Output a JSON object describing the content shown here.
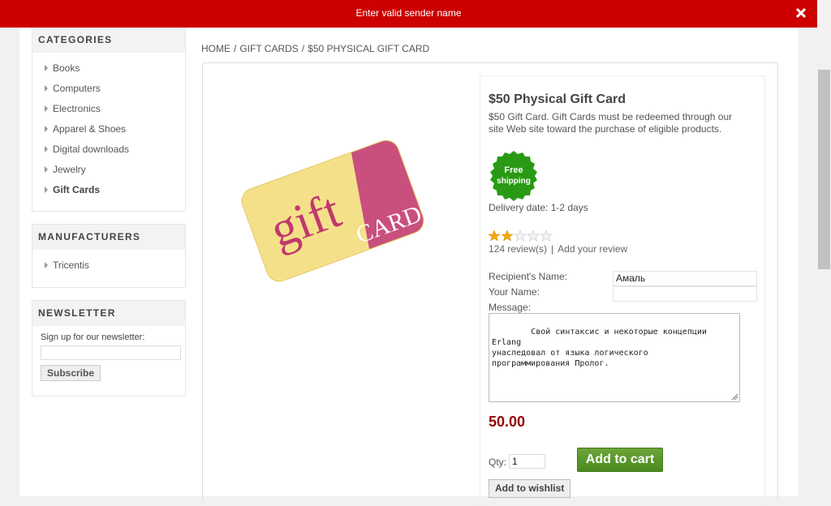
{
  "notification": {
    "text": "Enter valid sender name",
    "close_icon": "close-icon",
    "color": "#cc0000"
  },
  "sidebar": {
    "categories": {
      "title": "CATEGORIES",
      "items": [
        {
          "label": "Books"
        },
        {
          "label": "Computers"
        },
        {
          "label": "Electronics"
        },
        {
          "label": "Apparel & Shoes"
        },
        {
          "label": "Digital downloads"
        },
        {
          "label": "Jewelry"
        },
        {
          "label": "Gift Cards",
          "active": true
        }
      ]
    },
    "manufacturers": {
      "title": "MANUFACTURERS",
      "items": [
        {
          "label": "Tricentis"
        }
      ]
    },
    "newsletter": {
      "title": "NEWSLETTER",
      "label": "Sign up for our newsletter:",
      "input_value": "",
      "subscribe_label": "Subscribe"
    }
  },
  "breadcrumb": {
    "home": "HOME",
    "category": "GIFT CARDS",
    "current": "$50 PHYSICAL GIFT CARD",
    "separator": "/"
  },
  "product": {
    "image_text_main": "gift",
    "image_text_secondary": "CARD",
    "name": "$50 Physical Gift Card",
    "short_description": "$50 Gift Card. Gift Cards must be redeemed through our site Web site toward the purchase of eligible products.",
    "free_shipping_line1": "Free",
    "free_shipping_line2": "shipping",
    "delivery": "Delivery date: 1-2 days",
    "rating": 2,
    "rating_max": 5,
    "reviews_link": "124 review(s)",
    "reviews_sep": "|",
    "add_review_link": "Add your review",
    "recipient_label": "Recipient's Name:",
    "recipient_value": "Амаль",
    "sender_label": "Your Name:",
    "sender_value": "",
    "message_label": "Message:",
    "message_value": "Свой синтаксис и некоторые концепции Erlang\nунаследовал от языка логического\nпрограммирования Пролог.",
    "price": "50.00",
    "qty_label": "Qty:",
    "qty_value": "1",
    "add_to_cart_label": "Add to cart",
    "wishlist_label": "Add to wishlist"
  },
  "colors": {
    "price": "#990000",
    "add_to_cart": "#5a9a2a",
    "free_shipping": "#2a9a14"
  }
}
